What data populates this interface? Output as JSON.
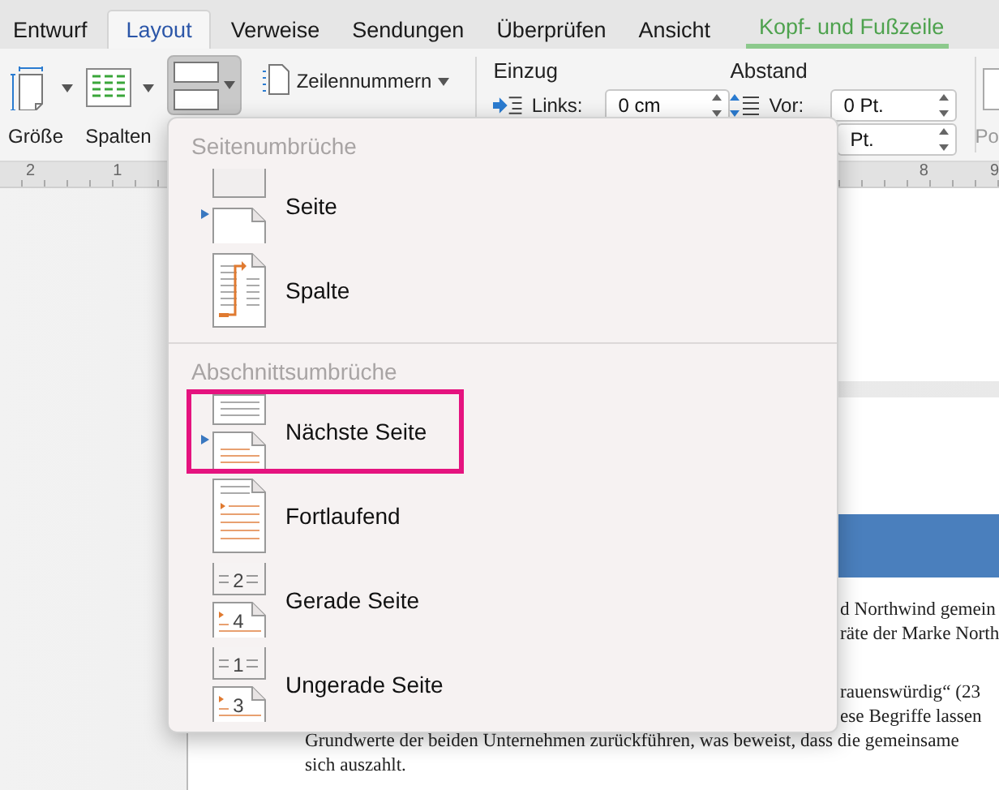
{
  "tabs": [
    {
      "label": "Entwurf",
      "selected": false,
      "kind": "normal"
    },
    {
      "label": "Layout",
      "selected": true,
      "kind": "normal"
    },
    {
      "label": "Verweise",
      "selected": false,
      "kind": "normal"
    },
    {
      "label": "Sendungen",
      "selected": false,
      "kind": "normal"
    },
    {
      "label": "Überprüfen",
      "selected": false,
      "kind": "normal"
    },
    {
      "label": "Ansicht",
      "selected": false,
      "kind": "normal"
    },
    {
      "label": "Kopf- und Fußzeile",
      "selected": false,
      "kind": "contextual"
    }
  ],
  "ribbon": {
    "size": {
      "label": "Größe"
    },
    "columns": {
      "label": "Spalten"
    },
    "breaks": {
      "pressed": true
    },
    "line_numbers": {
      "label": "Zeilennummern"
    },
    "indent": {
      "title": "Einzug",
      "left_label": "Links:",
      "left_value": "0 cm"
    },
    "spacing": {
      "title": "Abstand",
      "before_label": "Vor:",
      "before_value": "0 Pt.",
      "after_value": "Pt."
    },
    "position": {
      "label": "Po"
    }
  },
  "ruler": {
    "left_numbers": [
      "2",
      "1"
    ],
    "right_numbers": [
      "8",
      "9"
    ]
  },
  "menu": {
    "sections": [
      {
        "title": "Seitenumbrüche",
        "items": [
          {
            "label": "Seite",
            "kind": "page",
            "highlighted": false
          },
          {
            "label": "Spalte",
            "kind": "column",
            "highlighted": false
          }
        ]
      },
      {
        "title": "Abschnittsumbrüche",
        "items": [
          {
            "label": "Nächste Seite",
            "kind": "next-page",
            "highlighted": true
          },
          {
            "label": "Fortlaufend",
            "kind": "continuous",
            "highlighted": false
          },
          {
            "label": "Gerade Seite",
            "kind": "even-page",
            "highlighted": false,
            "page_numbers": [
              "2",
              "4"
            ]
          },
          {
            "label": "Ungerade Seite",
            "kind": "odd-page",
            "highlighted": false,
            "page_numbers": [
              "1",
              "3"
            ]
          }
        ]
      }
    ]
  },
  "document": {
    "paragraph_1": [
      "d Northwind gemein",
      "räte der Marke North"
    ],
    "paragraph_2": [
      "rauenswürdig“ (23",
      "ese Begriffe lassen"
    ],
    "paragraph_2_full": [
      "Grundwerte der beiden Unternehmen zurückführen, was beweist, dass die gemeinsame",
      "sich auszahlt."
    ]
  }
}
